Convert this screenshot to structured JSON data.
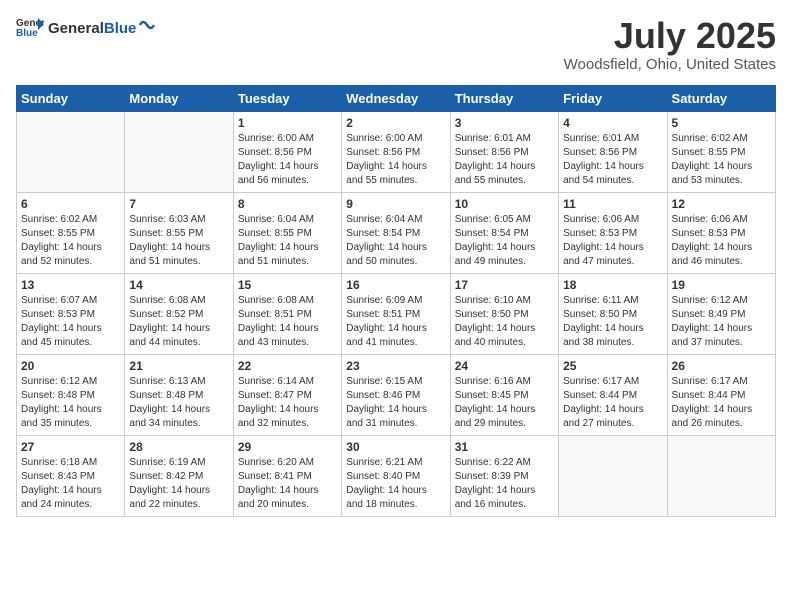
{
  "header": {
    "logo_general": "General",
    "logo_blue": "Blue",
    "month": "July 2025",
    "location": "Woodsfield, Ohio, United States"
  },
  "days_of_week": [
    "Sunday",
    "Monday",
    "Tuesday",
    "Wednesday",
    "Thursday",
    "Friday",
    "Saturday"
  ],
  "weeks": [
    [
      {
        "day": "",
        "info": ""
      },
      {
        "day": "",
        "info": ""
      },
      {
        "day": "1",
        "info": "Sunrise: 6:00 AM\nSunset: 8:56 PM\nDaylight: 14 hours and 56 minutes."
      },
      {
        "day": "2",
        "info": "Sunrise: 6:00 AM\nSunset: 8:56 PM\nDaylight: 14 hours and 55 minutes."
      },
      {
        "day": "3",
        "info": "Sunrise: 6:01 AM\nSunset: 8:56 PM\nDaylight: 14 hours and 55 minutes."
      },
      {
        "day": "4",
        "info": "Sunrise: 6:01 AM\nSunset: 8:56 PM\nDaylight: 14 hours and 54 minutes."
      },
      {
        "day": "5",
        "info": "Sunrise: 6:02 AM\nSunset: 8:55 PM\nDaylight: 14 hours and 53 minutes."
      }
    ],
    [
      {
        "day": "6",
        "info": "Sunrise: 6:02 AM\nSunset: 8:55 PM\nDaylight: 14 hours and 52 minutes."
      },
      {
        "day": "7",
        "info": "Sunrise: 6:03 AM\nSunset: 8:55 PM\nDaylight: 14 hours and 51 minutes."
      },
      {
        "day": "8",
        "info": "Sunrise: 6:04 AM\nSunset: 8:55 PM\nDaylight: 14 hours and 51 minutes."
      },
      {
        "day": "9",
        "info": "Sunrise: 6:04 AM\nSunset: 8:54 PM\nDaylight: 14 hours and 50 minutes."
      },
      {
        "day": "10",
        "info": "Sunrise: 6:05 AM\nSunset: 8:54 PM\nDaylight: 14 hours and 49 minutes."
      },
      {
        "day": "11",
        "info": "Sunrise: 6:06 AM\nSunset: 8:53 PM\nDaylight: 14 hours and 47 minutes."
      },
      {
        "day": "12",
        "info": "Sunrise: 6:06 AM\nSunset: 8:53 PM\nDaylight: 14 hours and 46 minutes."
      }
    ],
    [
      {
        "day": "13",
        "info": "Sunrise: 6:07 AM\nSunset: 8:53 PM\nDaylight: 14 hours and 45 minutes."
      },
      {
        "day": "14",
        "info": "Sunrise: 6:08 AM\nSunset: 8:52 PM\nDaylight: 14 hours and 44 minutes."
      },
      {
        "day": "15",
        "info": "Sunrise: 6:08 AM\nSunset: 8:51 PM\nDaylight: 14 hours and 43 minutes."
      },
      {
        "day": "16",
        "info": "Sunrise: 6:09 AM\nSunset: 8:51 PM\nDaylight: 14 hours and 41 minutes."
      },
      {
        "day": "17",
        "info": "Sunrise: 6:10 AM\nSunset: 8:50 PM\nDaylight: 14 hours and 40 minutes."
      },
      {
        "day": "18",
        "info": "Sunrise: 6:11 AM\nSunset: 8:50 PM\nDaylight: 14 hours and 38 minutes."
      },
      {
        "day": "19",
        "info": "Sunrise: 6:12 AM\nSunset: 8:49 PM\nDaylight: 14 hours and 37 minutes."
      }
    ],
    [
      {
        "day": "20",
        "info": "Sunrise: 6:12 AM\nSunset: 8:48 PM\nDaylight: 14 hours and 35 minutes."
      },
      {
        "day": "21",
        "info": "Sunrise: 6:13 AM\nSunset: 8:48 PM\nDaylight: 14 hours and 34 minutes."
      },
      {
        "day": "22",
        "info": "Sunrise: 6:14 AM\nSunset: 8:47 PM\nDaylight: 14 hours and 32 minutes."
      },
      {
        "day": "23",
        "info": "Sunrise: 6:15 AM\nSunset: 8:46 PM\nDaylight: 14 hours and 31 minutes."
      },
      {
        "day": "24",
        "info": "Sunrise: 6:16 AM\nSunset: 8:45 PM\nDaylight: 14 hours and 29 minutes."
      },
      {
        "day": "25",
        "info": "Sunrise: 6:17 AM\nSunset: 8:44 PM\nDaylight: 14 hours and 27 minutes."
      },
      {
        "day": "26",
        "info": "Sunrise: 6:17 AM\nSunset: 8:44 PM\nDaylight: 14 hours and 26 minutes."
      }
    ],
    [
      {
        "day": "27",
        "info": "Sunrise: 6:18 AM\nSunset: 8:43 PM\nDaylight: 14 hours and 24 minutes."
      },
      {
        "day": "28",
        "info": "Sunrise: 6:19 AM\nSunset: 8:42 PM\nDaylight: 14 hours and 22 minutes."
      },
      {
        "day": "29",
        "info": "Sunrise: 6:20 AM\nSunset: 8:41 PM\nDaylight: 14 hours and 20 minutes."
      },
      {
        "day": "30",
        "info": "Sunrise: 6:21 AM\nSunset: 8:40 PM\nDaylight: 14 hours and 18 minutes."
      },
      {
        "day": "31",
        "info": "Sunrise: 6:22 AM\nSunset: 8:39 PM\nDaylight: 14 hours and 16 minutes."
      },
      {
        "day": "",
        "info": ""
      },
      {
        "day": "",
        "info": ""
      }
    ]
  ]
}
